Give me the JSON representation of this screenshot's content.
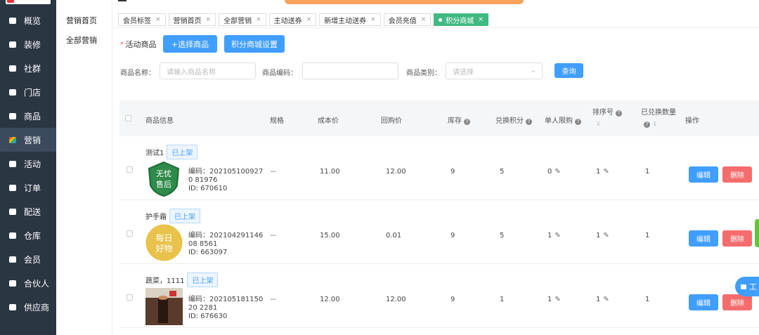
{
  "sidebar": {
    "items": [
      {
        "label": "概览"
      },
      {
        "label": "装修"
      },
      {
        "label": "社群"
      },
      {
        "label": "门店"
      },
      {
        "label": "商品"
      },
      {
        "label": "营销",
        "active": true
      },
      {
        "label": "活动"
      },
      {
        "label": "订单"
      },
      {
        "label": "配送"
      },
      {
        "label": "仓库"
      },
      {
        "label": "会员"
      },
      {
        "label": "合伙人"
      },
      {
        "label": "供应商"
      }
    ]
  },
  "subnav": {
    "items": [
      {
        "label": "营销首页"
      },
      {
        "label": "全部营销"
      }
    ]
  },
  "tabs": [
    {
      "label": "会员标签"
    },
    {
      "label": "营销首页"
    },
    {
      "label": "全部营销"
    },
    {
      "label": "主动送券"
    },
    {
      "label": "新增主动送券"
    },
    {
      "label": "会员充值"
    },
    {
      "label": "积分商城",
      "active": true
    }
  ],
  "tab_close": "×",
  "actions": {
    "required_label": "活动商品",
    "required_mark": "*",
    "select_goods": "+选择商品",
    "mall_settings": "积分商城设置"
  },
  "filters": {
    "name_label": "商品名称：",
    "name_placeholder": "请输入商品名称",
    "code_label": "商品编码：",
    "code_value": "",
    "category_label": "商品类别：",
    "category_placeholder": "请选择",
    "query": "查询"
  },
  "table": {
    "headers": {
      "info": "商品信息",
      "spec": "规格",
      "cost": "成本价",
      "price": "回购价",
      "stock": "库存",
      "points": "兑换积分",
      "limit": "单人限购",
      "sort": "排序号",
      "exchanged": "已兑换数量",
      "ops": "操作"
    },
    "rows": [
      {
        "name": "测试1",
        "status": "已上架",
        "thumb_text": [
          "无忧",
          "售后"
        ],
        "code": "编码：2021051009270 81976",
        "id": "ID: 670610",
        "spec": "--",
        "cost": "11.00",
        "price": "12.00",
        "stock": "9",
        "points": "5",
        "limit": "0",
        "sort": "1",
        "exchanged": "1"
      },
      {
        "name": "护手霜",
        "status": "已上架",
        "thumb_text": [
          "每日",
          "好物"
        ],
        "code": "编码：20210429114608 8561",
        "id": "ID: 663097",
        "spec": "--",
        "cost": "15.00",
        "price": "0.01",
        "stock": "9",
        "points": "5",
        "limit": "1",
        "sort": "1",
        "exchanged": "1"
      },
      {
        "name": "蔬菜，1111",
        "status": "已上架",
        "thumb_text": [
          "",
          ""
        ],
        "code": "编码：20210518115020 2281",
        "id": "ID: 676630",
        "spec": "--",
        "cost": "12.00",
        "price": "12.00",
        "stock": "9",
        "points": "1",
        "limit": "1",
        "sort": "1",
        "exchanged": "1"
      }
    ],
    "edit_label": "编辑",
    "delete_label": "删除"
  },
  "float_tool": "工"
}
